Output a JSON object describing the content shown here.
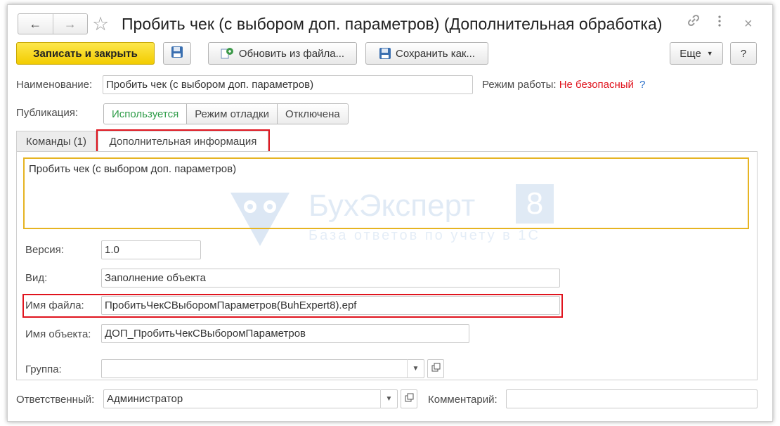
{
  "window": {
    "title": "Пробить чек (с выбором доп. параметров) (Дополнительная обработка)",
    "back_icon": "←",
    "forward_icon": "→"
  },
  "toolbar": {
    "save_close_label": "Записать и закрыть",
    "update_from_file_label": "Обновить из файла...",
    "save_as_label": "Сохранить как...",
    "more_label": "Еще",
    "help_label": "?"
  },
  "form": {
    "name_label": "Наименование:",
    "name_value": "Пробить чек (с выбором доп. параметров)",
    "mode_label": "Режим работы:",
    "mode_value": "Не безопасный",
    "mode_help": "?",
    "publication_label": "Публикация:",
    "publication_options": [
      "Используется",
      "Режим отладки",
      "Отключена"
    ],
    "publication_selected": "Используется"
  },
  "tabs": [
    {
      "label": "Команды (1)"
    },
    {
      "label": "Дополнительная информация"
    }
  ],
  "info": {
    "description": "Пробить чек (с выбором доп. параметров)",
    "version_label": "Версия:",
    "version_value": "1.0",
    "kind_label": "Вид:",
    "kind_value": "Заполнение объекта",
    "filename_label": "Имя файла:",
    "filename_value": "ПробитьЧекСВыборомПараметров(BuhExpert8).epf",
    "objectname_label": "Имя объекта:",
    "objectname_value": "ДОП_ПробитьЧекСВыборомПараметров",
    "group_label": "Группа:",
    "group_value": ""
  },
  "footer": {
    "responsible_label": "Ответственный:",
    "responsible_value": "Администратор",
    "comment_label": "Комментарий:",
    "comment_value": ""
  },
  "watermark": {
    "brand": "БухЭксперт",
    "brand_digit": "8",
    "tagline": "База ответов по учету в 1С"
  },
  "colors": {
    "primary_button": "#f6d31a",
    "active_publication": "#2e9c48",
    "mode_value": "#e0141e",
    "highlight_outline": "#e0141e",
    "description_border": "#e6b422"
  }
}
